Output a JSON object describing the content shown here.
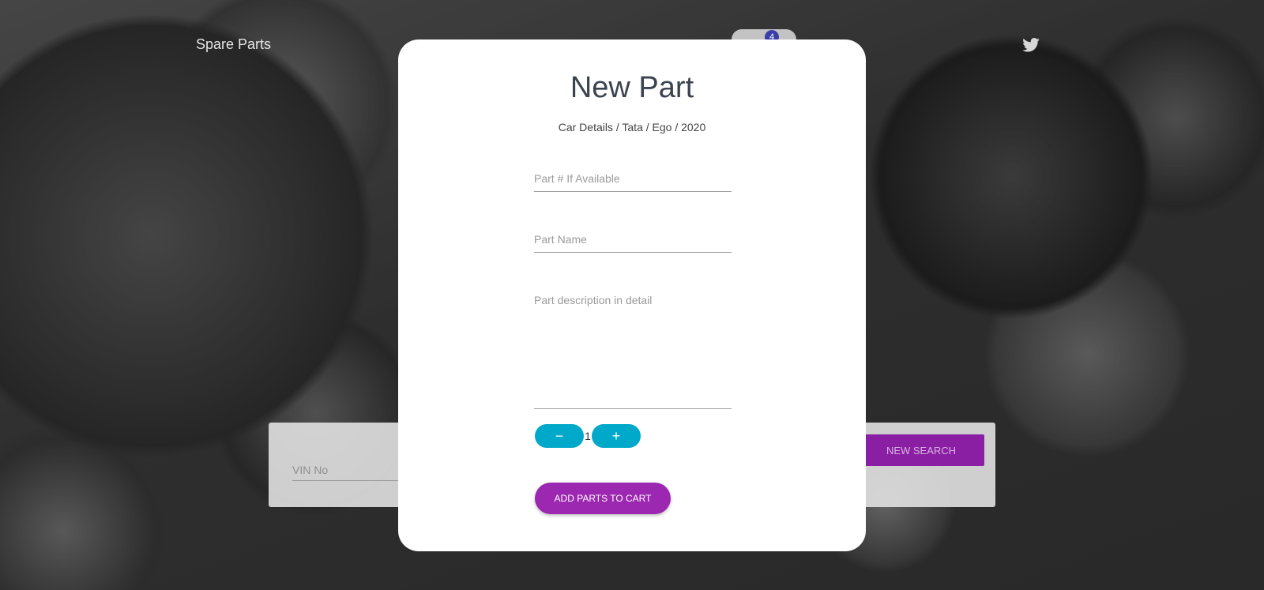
{
  "header": {
    "brand": "Spare Parts",
    "cart_count": "4",
    "twitter_icon": "twitter-icon"
  },
  "search_panel": {
    "vin_placeholder": "VIN No",
    "new_search_label": "NEW SEARCH"
  },
  "modal": {
    "title": "New Part",
    "breadcrumb": "Car Details / Tata / Ego / 2020",
    "part_number_placeholder": "Part # If Available",
    "part_name_placeholder": "Part Name",
    "description_placeholder": "Part description in detail",
    "quantity": "1",
    "minus_symbol": "−",
    "plus_symbol": "+",
    "add_to_cart_label": "ADD PARTS TO CART"
  },
  "colors": {
    "accent_purple": "#9c27b0",
    "stepper_cyan": "#00a9c9",
    "badge_blue": "#3a3fa8"
  }
}
